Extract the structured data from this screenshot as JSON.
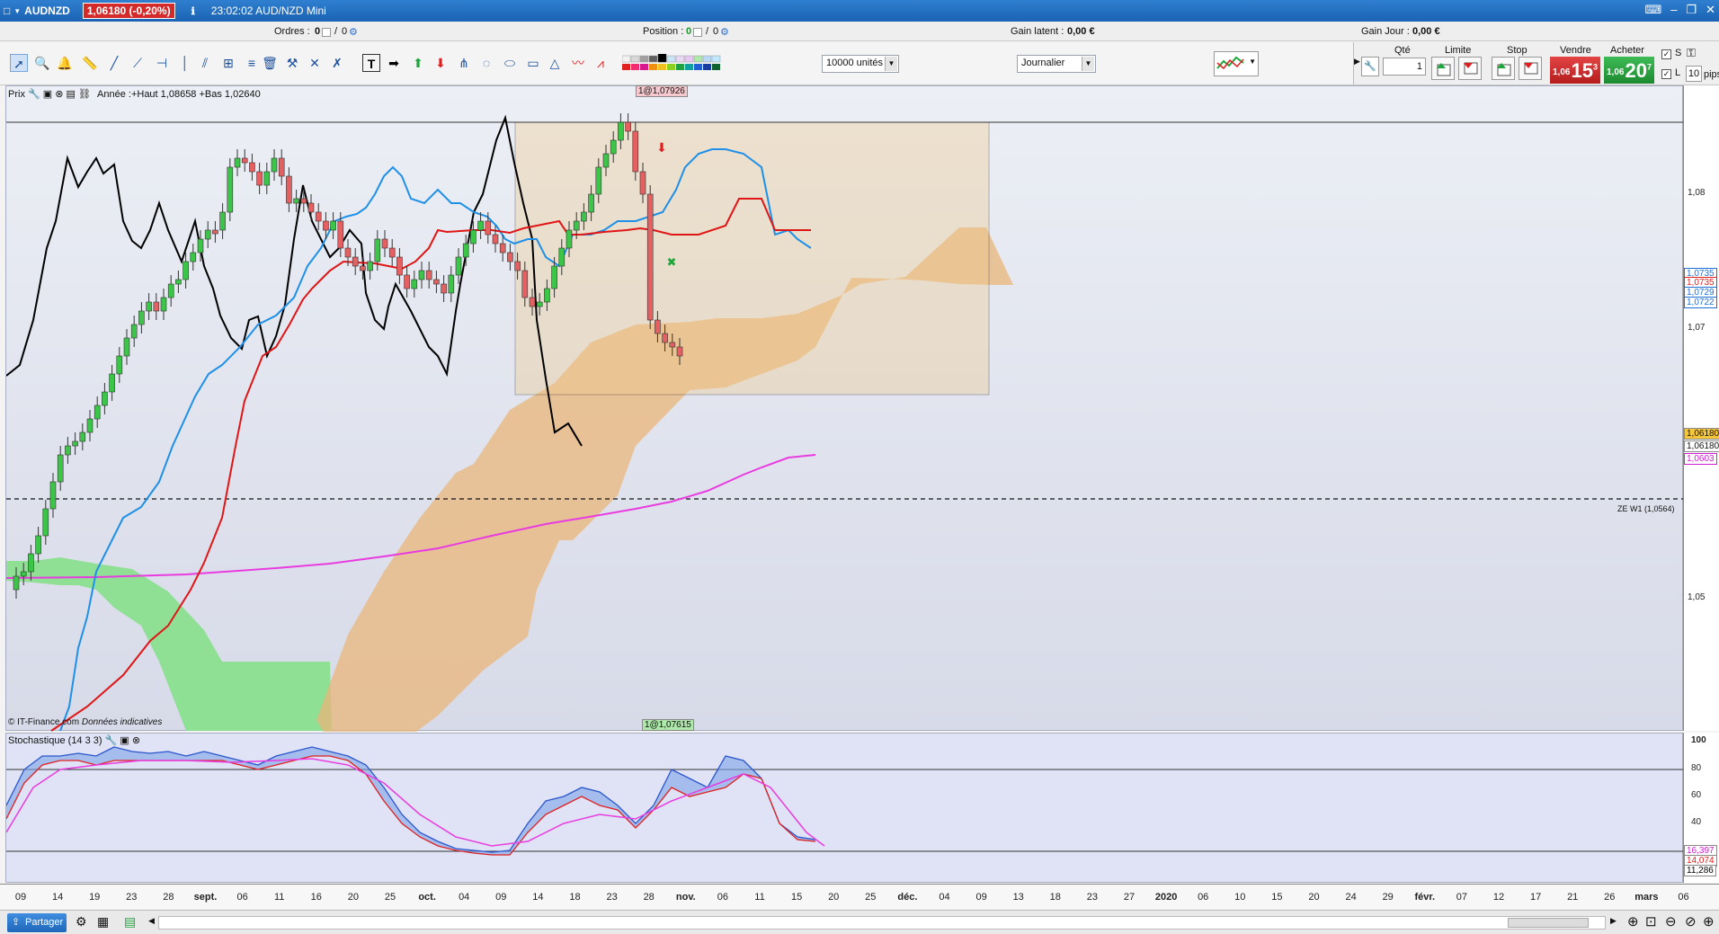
{
  "window": {
    "symbol": "AUDNZD",
    "price_change": "1,06180 (-0,20%)",
    "info": "23:02:02 AUD/NZD Mini"
  },
  "orderbar": {
    "orders_label": "Ordres :",
    "orders_value": "0",
    "orders_sep": "/",
    "orders_value2": "0",
    "position_label": "Position :",
    "position_value": "0",
    "position_sep": "/",
    "position_value2": "0",
    "gain_latent_label": "Gain latent :",
    "gain_latent_value": "0,00 €",
    "gain_jour_label": "Gain Jour :",
    "gain_jour_value": "0,00 €"
  },
  "toolbar": {
    "units_select": "10000 unités",
    "period_select": "Journalier"
  },
  "trade": {
    "qty_label": "Qté",
    "qty_value": "1",
    "limit_label": "Limite",
    "stop_label": "Stop",
    "sell_label": "Vendre",
    "buy_label": "Acheter",
    "sell_price_small": "1,06",
    "sell_price_big": "15",
    "sell_price_sup": "3",
    "buy_price_small": "1,06",
    "buy_price_big": "20",
    "buy_price_sup": "7",
    "check_s": "S",
    "check_l": "L",
    "pips_value": "10",
    "pips_label": "pips"
  },
  "chart": {
    "legend_title": "Prix",
    "legend_text": "Année :+Haut 1,08658 +Bas 1,02640",
    "top_tag": "1@1,07926",
    "bottom_tag": "1@1,07615",
    "zone_label": "ZE W1 (1,0564)",
    "copyright": "© IT-Finance.com",
    "copyright_note": "Données indicatives",
    "price_ticks": [
      "1,08",
      "1,07",
      "1,05"
    ],
    "right_tags": [
      {
        "label": "1,0735",
        "color": "#ffffff",
        "text": "#1b6fd6"
      },
      {
        "label": "1,0729",
        "color": "#ffffff",
        "text": "#1b6fd6"
      },
      {
        "label": "1,0722",
        "color": "#ffffff",
        "text": "#1b6fd6"
      },
      {
        "label": "1,06180",
        "color": "#f6c73a",
        "text": "#000000"
      },
      {
        "label": "1,06180",
        "color": "#ffffff",
        "text": "#000000"
      },
      {
        "label": "1,0603",
        "color": "#ffffff",
        "text": "#d21ed2"
      }
    ]
  },
  "stochastic": {
    "legend": "Stochastique (14 3 3)",
    "ticks": [
      "100",
      "80",
      "60",
      "40"
    ],
    "right_tags": [
      "16,397",
      "14,074",
      "11,286"
    ]
  },
  "dates": [
    {
      "label": "09",
      "bold": false
    },
    {
      "label": "14",
      "bold": false
    },
    {
      "label": "19",
      "bold": false
    },
    {
      "label": "23",
      "bold": false
    },
    {
      "label": "28",
      "bold": false
    },
    {
      "label": "sept.",
      "bold": true
    },
    {
      "label": "06",
      "bold": false
    },
    {
      "label": "11",
      "bold": false
    },
    {
      "label": "16",
      "bold": false
    },
    {
      "label": "20",
      "bold": false
    },
    {
      "label": "25",
      "bold": false
    },
    {
      "label": "oct.",
      "bold": true
    },
    {
      "label": "04",
      "bold": false
    },
    {
      "label": "09",
      "bold": false
    },
    {
      "label": "14",
      "bold": false
    },
    {
      "label": "18",
      "bold": false
    },
    {
      "label": "23",
      "bold": false
    },
    {
      "label": "28",
      "bold": false
    },
    {
      "label": "nov.",
      "bold": true
    },
    {
      "label": "06",
      "bold": false
    },
    {
      "label": "11",
      "bold": false
    },
    {
      "label": "15",
      "bold": false
    },
    {
      "label": "20",
      "bold": false
    },
    {
      "label": "25",
      "bold": false
    },
    {
      "label": "déc.",
      "bold": true
    },
    {
      "label": "04",
      "bold": false
    },
    {
      "label": "09",
      "bold": false
    },
    {
      "label": "13",
      "bold": false
    },
    {
      "label": "18",
      "bold": false
    },
    {
      "label": "23",
      "bold": false
    },
    {
      "label": "27",
      "bold": false
    },
    {
      "label": "2020",
      "bold": true
    },
    {
      "label": "06",
      "bold": false
    },
    {
      "label": "10",
      "bold": false
    },
    {
      "label": "15",
      "bold": false
    },
    {
      "label": "20",
      "bold": false
    },
    {
      "label": "24",
      "bold": false
    },
    {
      "label": "29",
      "bold": false
    },
    {
      "label": "févr.",
      "bold": true
    },
    {
      "label": "07",
      "bold": false
    },
    {
      "label": "12",
      "bold": false
    },
    {
      "label": "17",
      "bold": false
    },
    {
      "label": "21",
      "bold": false
    },
    {
      "label": "26",
      "bold": false
    },
    {
      "label": "mars",
      "bold": true
    },
    {
      "label": "06",
      "bold": false
    }
  ],
  "bottom": {
    "share_label": "Partager"
  },
  "colors": {
    "bull": "#3cc548",
    "bear": "#e56060",
    "kijun": "#e01515",
    "tenkan": "#1e90e8",
    "chikou": "#000000",
    "ma": "#e83ce0",
    "cloud_bull": "#86e08c",
    "cloud_bear": "#eab67a"
  }
}
